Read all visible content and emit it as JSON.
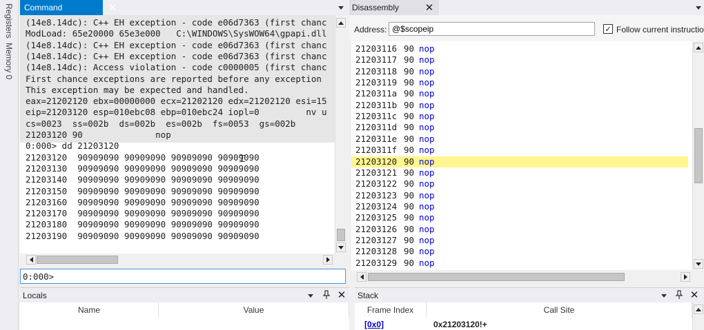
{
  "left_strip": {
    "tabs": [
      "Registers",
      "Memory 0"
    ]
  },
  "command": {
    "title": "Command",
    "output_lines": [
      "(14e8.14dc): C++ EH exception - code e06d7363 (first chanc",
      "ModLoad: 65e20000 65e3e000   C:\\WINDOWS\\SysWOW64\\gpapi.dll",
      "(14e8.14dc): C++ EH exception - code e06d7363 (first chanc",
      "(14e8.14dc): C++ EH exception - code e06d7363 (first chanc",
      "(14e8.14dc): Access violation - code c0000005 (first chanc",
      "First chance exceptions are reported before any exception",
      "This exception may be expected and handled.",
      "eax=21202120 ebx=00000000 ecx=21202120 edx=21202120 esi=15",
      "eip=21203120 esp=010ebc08 ebp=010ebc24 iopl=0         nv u",
      "cs=0023  ss=002b  ds=002b  es=002b  fs=0053  gs=002b",
      "21203120 90              nop",
      "0:000> dd 21203120",
      "21203120  90909090 90909090 90909090 90909090",
      "21203130  90909090 90909090 90909090 90909090",
      "21203140  90909090 90909090 90909090 90909090",
      "21203150  90909090 90909090 90909090 90909090",
      "21203160  90909090 90909090 90909090 90909090",
      "21203170  90909090 90909090 90909090 90909090",
      "21203180  90909090 90909090 90909090 90909090",
      "21203190  90909090 90909090 90909090 90909090"
    ],
    "prompt": "0:000>",
    "input_value": ""
  },
  "disassembly": {
    "title": "Disassembly",
    "address_label": "Address:",
    "address_value": "@$scopeip",
    "follow_label": "Follow current instructio",
    "follow_checked": true,
    "highlight_color": "#fff68f",
    "rows": [
      {
        "addr": "21203116",
        "op": "90",
        "mn": "nop",
        "current": false
      },
      {
        "addr": "21203117",
        "op": "90",
        "mn": "nop",
        "current": false
      },
      {
        "addr": "21203118",
        "op": "90",
        "mn": "nop",
        "current": false
      },
      {
        "addr": "21203119",
        "op": "90",
        "mn": "nop",
        "current": false
      },
      {
        "addr": "2120311a",
        "op": "90",
        "mn": "nop",
        "current": false
      },
      {
        "addr": "2120311b",
        "op": "90",
        "mn": "nop",
        "current": false
      },
      {
        "addr": "2120311c",
        "op": "90",
        "mn": "nop",
        "current": false
      },
      {
        "addr": "2120311d",
        "op": "90",
        "mn": "nop",
        "current": false
      },
      {
        "addr": "2120311e",
        "op": "90",
        "mn": "nop",
        "current": false
      },
      {
        "addr": "2120311f",
        "op": "90",
        "mn": "nop",
        "current": false
      },
      {
        "addr": "21203120",
        "op": "90",
        "mn": "nop",
        "current": true
      },
      {
        "addr": "21203121",
        "op": "90",
        "mn": "nop",
        "current": false
      },
      {
        "addr": "21203122",
        "op": "90",
        "mn": "nop",
        "current": false
      },
      {
        "addr": "21203123",
        "op": "90",
        "mn": "nop",
        "current": false
      },
      {
        "addr": "21203124",
        "op": "90",
        "mn": "nop",
        "current": false
      },
      {
        "addr": "21203125",
        "op": "90",
        "mn": "nop",
        "current": false
      },
      {
        "addr": "21203126",
        "op": "90",
        "mn": "nop",
        "current": false
      },
      {
        "addr": "21203127",
        "op": "90",
        "mn": "nop",
        "current": false
      },
      {
        "addr": "21203128",
        "op": "90",
        "mn": "nop",
        "current": false
      },
      {
        "addr": "21203129",
        "op": "90",
        "mn": "nop",
        "current": false
      }
    ]
  },
  "locals": {
    "title": "Locals",
    "columns": [
      "Name",
      "Value"
    ]
  },
  "stack": {
    "title": "Stack",
    "columns": [
      "Frame Index",
      "Call Site"
    ],
    "rows": [
      {
        "frame": "[0x0]",
        "call_site": "0x21203120!+"
      }
    ]
  },
  "colors": {
    "accent": "#007acc",
    "link": "#0000cd"
  }
}
